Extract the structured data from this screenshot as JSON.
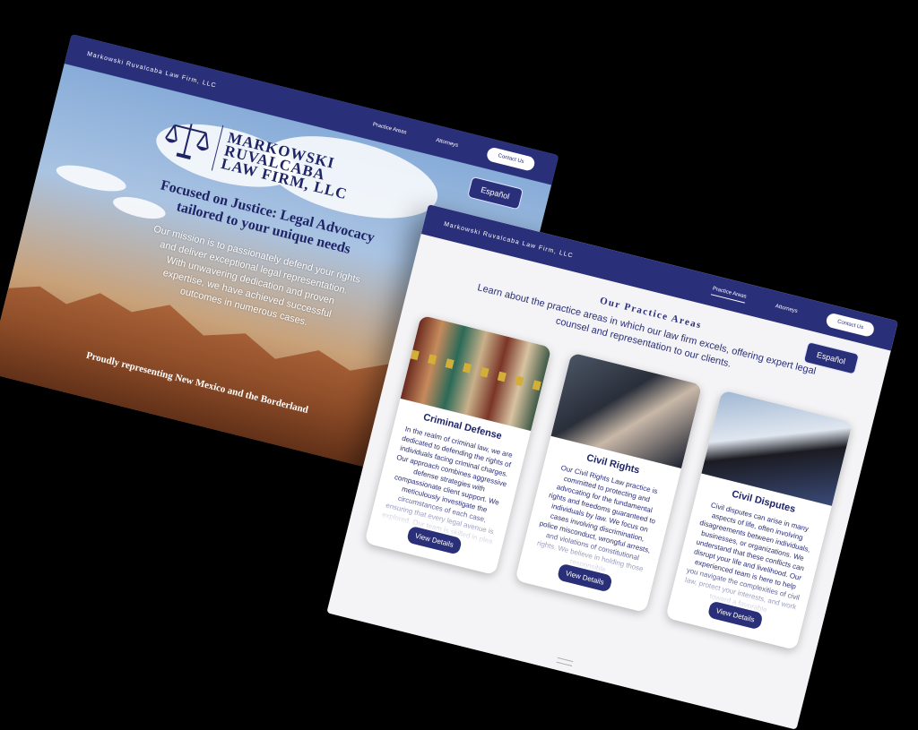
{
  "hero": {
    "brand": "Markowski Ruvalcaba Law Firm, LLC",
    "nav": {
      "practice": "Practice Areas",
      "attorneys": "Attorneys",
      "contact": "Contact Us"
    },
    "espanol": "Español",
    "logo": {
      "line1": "MARKOWSKI",
      "line2": "RUVALCABA",
      "line3": "LAW FIRM, LLC"
    },
    "headline": "Focused on Justice: Legal Advocacy tailored to your unique needs",
    "body": "Our mission is to passionately defend your rights and deliver exceptional legal representation. With unwavering dedication and proven expertise, we have achieved successful outcomes in numerous cases.",
    "footer": "Proudly representing New Mexico and the Borderland"
  },
  "practice": {
    "brand": "Markowski Ruvalcaba Law Firm, LLC",
    "nav": {
      "practice": "Practice Areas",
      "attorneys": "Attorneys",
      "contact": "Contact Us"
    },
    "espanol": "Español",
    "title": "Our Practice Areas",
    "subtitle": "Learn about the practice areas in which our law firm excels, offering expert legal counsel and representation to our clients.",
    "cards": [
      {
        "title": "Criminal Defense",
        "body": "In the realm of criminal law, we are dedicated to defending the rights of individuals facing criminal charges. Our approach combines aggressive defense strategies with compassionate client support. We meticulously investigate the circumstances of each case, ensuring that every legal avenue is explored. Our team is skilled in plea deals and courtroom",
        "button": "View Details"
      },
      {
        "title": "Civil Rights",
        "body": "Our Civil Rights Law practice is committed to protecting and advocating for the fundamental rights and freedoms guaranteed to individuals by law. We focus on cases involving discrimination, police misconduct, wrongful arrests, and violations of constitutional rights. We believe in holding those responsible",
        "button": "View Details"
      },
      {
        "title": "Civil Disputes",
        "body": "Civil disputes can arise in many aspects of life, often involving disagreements between individuals, businesses, or organizations. We understand that these conflicts can disrupt your life and livelihood. Our experienced team is here to help you navigate the complexities of civil law, protect your interests, and work toward a favorable",
        "button": "View Details"
      }
    ]
  },
  "colors": {
    "navy": "#2a2f7a",
    "background": "#f4f4f6"
  }
}
